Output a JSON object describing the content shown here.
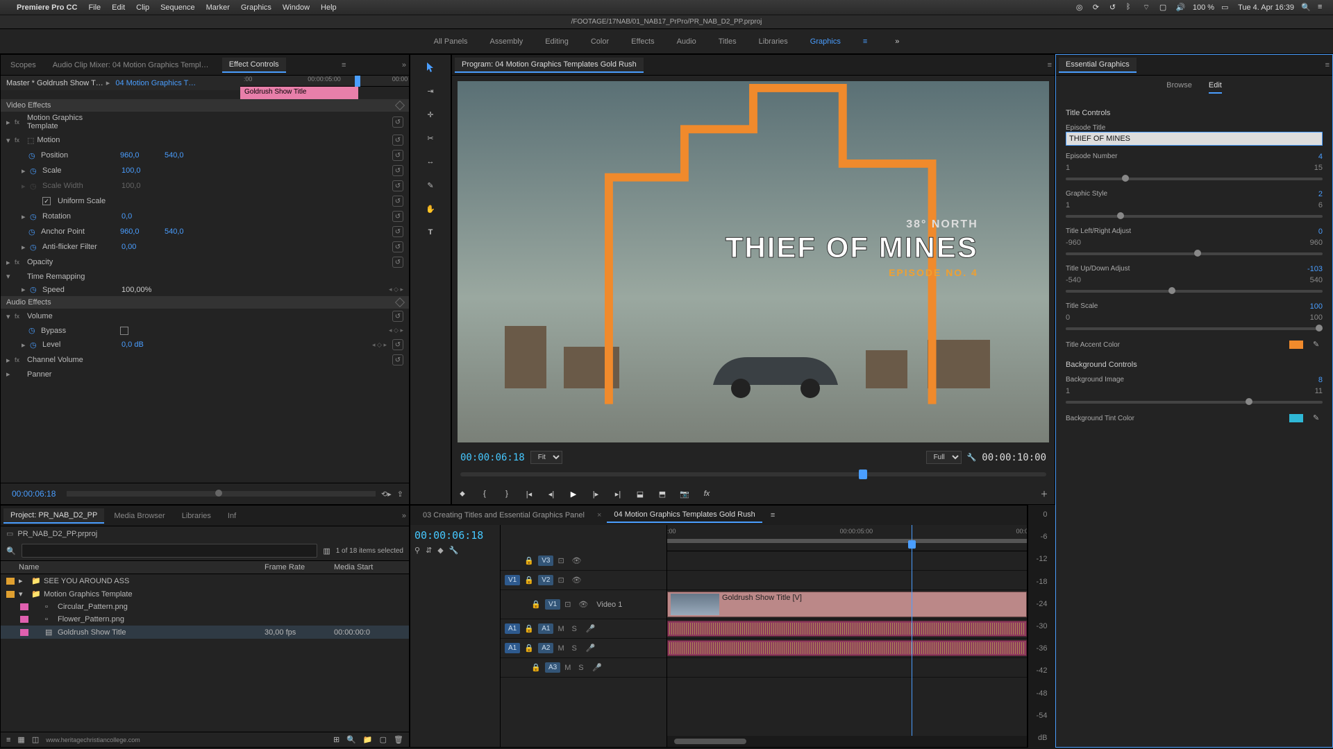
{
  "mac": {
    "apple": "",
    "app": "Premiere Pro CC",
    "menus": [
      "File",
      "Edit",
      "Clip",
      "Sequence",
      "Marker",
      "Graphics",
      "Window",
      "Help"
    ],
    "right": {
      "battery": "100 %",
      "clock": "Tue 4. Apr 16:39"
    }
  },
  "docPath": "/FOOTAGE/17NAB/01_NAB17_PrPro/PR_NAB_D2_PP.prproj",
  "workspaces": {
    "items": [
      "All Panels",
      "Assembly",
      "Editing",
      "Color",
      "Effects",
      "Audio",
      "Titles",
      "Libraries",
      "Graphics"
    ],
    "active": 8
  },
  "effectControls": {
    "tabs": [
      "Scopes",
      "Audio Clip Mixer: 04 Motion Graphics Templates Gold Rush",
      "Effect Controls"
    ],
    "activeTab": 2,
    "masterClip": "Master * Goldrush Show T…",
    "sequenceClip": "04 Motion Graphics T…",
    "timelineTicks": [
      {
        "t": ":00",
        "pos": 2
      },
      {
        "t": "00:00:05:00",
        "pos": 48
      },
      {
        "t": "00:00",
        "pos": 95
      }
    ],
    "playheadPos": 68,
    "clipName": "Goldrush Show Title",
    "videoEffectsLabel": "Video Effects",
    "audioEffectsLabel": "Audio Effects",
    "motionGraphicsTemplate": "Motion Graphics Template",
    "motion": {
      "label": "Motion",
      "position": {
        "label": "Position",
        "x": "960,0",
        "y": "540,0"
      },
      "scale": {
        "label": "Scale",
        "v": "100,0"
      },
      "scaleWidth": {
        "label": "Scale Width",
        "v": "100,0"
      },
      "uniform": {
        "label": "Uniform Scale",
        "checked": true
      },
      "rotation": {
        "label": "Rotation",
        "v": "0,0"
      },
      "anchor": {
        "label": "Anchor Point",
        "x": "960,0",
        "y": "540,0"
      },
      "antiflicker": {
        "label": "Anti-flicker Filter",
        "v": "0,00"
      }
    },
    "opacity": {
      "label": "Opacity"
    },
    "timeRemap": {
      "label": "Time Remapping",
      "speed": {
        "label": "Speed",
        "v": "100,00%"
      }
    },
    "volume": {
      "label": "Volume",
      "bypass": {
        "label": "Bypass"
      },
      "level": {
        "label": "Level",
        "v": "0,0 dB"
      }
    },
    "channelVolume": "Channel Volume",
    "panner": "Panner",
    "currentTime": "00:00:06:18"
  },
  "tools": [
    "selection",
    "track-select",
    "ripple",
    "razor",
    "slip",
    "pen",
    "hand",
    "type"
  ],
  "program": {
    "tabLabel": "Program: 04 Motion Graphics Templates Gold Rush",
    "overlay": {
      "sub1": "38° NORTH",
      "main": "THIEF OF MINES",
      "sub2": "EPISODE NO. 4"
    },
    "leftTC": "00:00:06:18",
    "zoom": "Fit",
    "res": "Full",
    "rightTC": "00:00:10:00",
    "scrubPos": 68,
    "transport": [
      "marker-add",
      "in",
      "out",
      "goto-in",
      "step-back",
      "play",
      "step-fwd",
      "goto-out",
      "lift",
      "extract",
      "export-frame",
      "fx"
    ]
  },
  "essentialGraphics": {
    "panelTitle": "Essential Graphics",
    "tabs": [
      "Browse",
      "Edit"
    ],
    "activeTab": 1,
    "titleControls": "Title Controls",
    "episodeTitle": {
      "label": "Episode Title",
      "value": "THIEF OF MINES"
    },
    "episodeNumber": {
      "label": "Episode Number",
      "value": "4",
      "min": "1",
      "max": "15",
      "slider": 22
    },
    "graphicStyle": {
      "label": "Graphic Style",
      "value": "2",
      "min": "1",
      "max": "6",
      "slider": 20
    },
    "titleLR": {
      "label": "Title Left/Right Adjust",
      "value": "0",
      "min": "-960",
      "max": "960",
      "slider": 50
    },
    "titleUD": {
      "label": "Title Up/Down Adjust",
      "value": "-103",
      "min": "-540",
      "max": "540",
      "slider": 40
    },
    "titleScale": {
      "label": "Title Scale",
      "value": "100",
      "min": "0",
      "max": "100",
      "slider": 100
    },
    "accentColor": {
      "label": "Title Accent Color",
      "hex": "#f08a2c"
    },
    "backgroundControls": "Background Controls",
    "bgImage": {
      "label": "Background Image",
      "value": "8",
      "min": "1",
      "max": "11",
      "slider": 70
    },
    "bgTint": {
      "label": "Background Tint Color",
      "hex": "#2fb8d6"
    }
  },
  "project": {
    "tabs": [
      "Project: PR_NAB_D2_PP",
      "Media Browser",
      "Libraries",
      "Inf"
    ],
    "activeTab": 0,
    "filename": "PR_NAB_D2_PP.prproj",
    "status": "1 of 18 items selected",
    "cols": [
      "Name",
      "Frame Rate",
      "Media Start"
    ],
    "items": [
      {
        "color": "#e0a030",
        "icon": "bin",
        "name": "SEE YOU AROUND ASS"
      },
      {
        "color": "#e0a030",
        "icon": "bin",
        "name": "Motion Graphics Template",
        "expanded": true
      },
      {
        "color": "#e060b0",
        "icon": "img",
        "name": "Circular_Pattern.png",
        "indent": 1
      },
      {
        "color": "#e060b0",
        "icon": "img",
        "name": "Flower_Pattern.png",
        "indent": 1
      },
      {
        "color": "#e060b0",
        "icon": "seq",
        "name": "Goldrush Show Title",
        "indent": 1,
        "frameRate": "30,00 fps",
        "mediaStart": "00:00:00:0"
      }
    ],
    "footer": "www.heritagechristiancollege.com"
  },
  "timeline": {
    "tabs": [
      "03 Creating Titles and Essential Graphics Panel",
      "04 Motion Graphics Templates Gold Rush"
    ],
    "activeTab": 1,
    "timecode": "00:00:06:18",
    "rulerTicks": [
      {
        "t": ":00",
        "pos": 0
      },
      {
        "t": "00:00:05:00",
        "pos": 48
      },
      {
        "t": "00:0",
        "pos": 98
      }
    ],
    "playheadPos": 68,
    "tracks": {
      "v3": {
        "label": "V3"
      },
      "v2": {
        "label": "V2"
      },
      "v1": {
        "label": "V1",
        "srcTag": "V1",
        "patchLabel": "Video 1"
      },
      "a1": {
        "label": "A1",
        "srcTag": "A1"
      },
      "a2": {
        "label": "A2",
        "srcTag": "A1"
      },
      "a3": {
        "label": "A3"
      }
    },
    "clips": {
      "v1": {
        "name": "Goldrush Show Title [V]",
        "start": 0,
        "end": 100
      },
      "a1": {
        "start": 0,
        "end": 100
      },
      "a2": {
        "start": 0,
        "end": 100
      }
    },
    "meters": [
      "0",
      "-6",
      "-12",
      "-18",
      "-24",
      "-30",
      "-36",
      "-42",
      "-48",
      "-54",
      "dB"
    ]
  }
}
